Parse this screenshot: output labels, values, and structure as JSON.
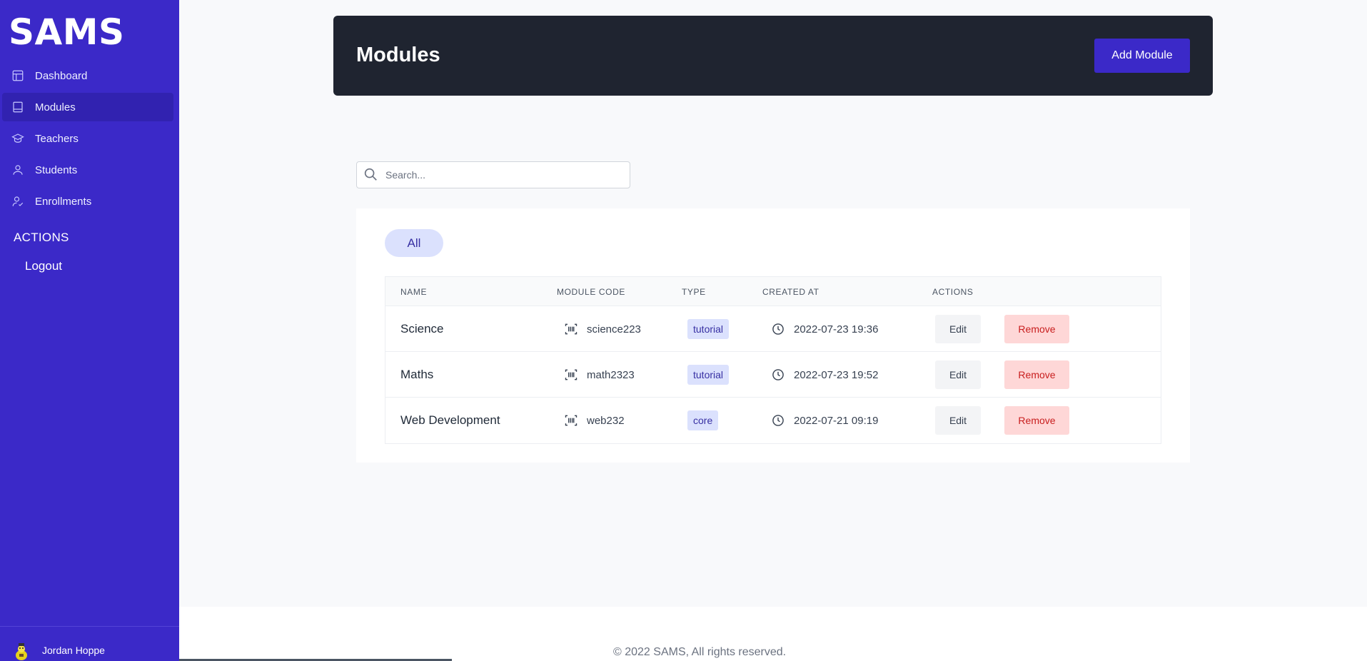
{
  "app": {
    "logo": "SAMS"
  },
  "sidebar": {
    "items": [
      {
        "label": "Dashboard",
        "icon": "dashboard-icon"
      },
      {
        "label": "Modules",
        "icon": "book-icon",
        "active": true
      },
      {
        "label": "Teachers",
        "icon": "graduation-cap-icon"
      },
      {
        "label": "Students",
        "icon": "user-icon"
      },
      {
        "label": "Enrollments",
        "icon": "user-check-icon"
      }
    ],
    "actions_heading": "ACTIONS",
    "logout_label": "Logout",
    "user": {
      "name": "Jordan Hoppe"
    }
  },
  "header": {
    "title": "Modules",
    "add_button": "Add Module"
  },
  "search": {
    "placeholder": "Search...",
    "value": ""
  },
  "filters": {
    "all_label": "All"
  },
  "table": {
    "columns": [
      "NAME",
      "MODULE CODE",
      "TYPE",
      "CREATED AT",
      "ACTIONS"
    ],
    "rows": [
      {
        "name": "Science",
        "code": "science223",
        "type": "tutorial",
        "created": "2022-07-23 19:36",
        "edit": "Edit",
        "remove": "Remove"
      },
      {
        "name": "Maths",
        "code": "math2323",
        "type": "tutorial",
        "created": "2022-07-23 19:52",
        "edit": "Edit",
        "remove": "Remove"
      },
      {
        "name": "Web Development",
        "code": "web232",
        "type": "core",
        "created": "2022-07-21 09:19",
        "edit": "Edit",
        "remove": "Remove"
      }
    ]
  },
  "footer": {
    "copyright": "© 2022 SAMS, All rights reserved."
  },
  "colors": {
    "brand": "#3b29c8",
    "header_bg": "#1f2430",
    "badge_bg": "#dbe1fd",
    "danger_bg": "#fed7d7",
    "danger_text": "#c81e1e"
  }
}
